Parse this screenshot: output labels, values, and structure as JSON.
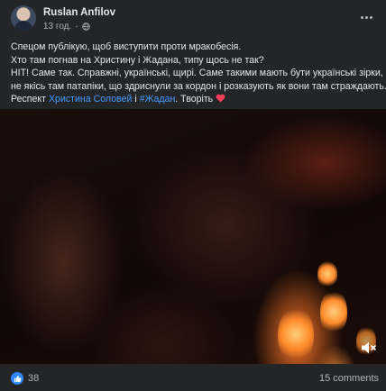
{
  "post": {
    "author": "Ruslan Anfilov",
    "time": "13 год.",
    "lines": [
      "Спецом публікую, щоб виступити проти мракобесія.",
      "Хто там погнав на Христину і Жадана, типу щось не так?",
      "НІТ! Саме так. Справжні, українські, щирі. Саме такими мають бути українські зірки, а",
      "не якісь там пaтапіки, що здриснули за кордон і розказують як вони там страждають."
    ],
    "respect_prefix": "Респект",
    "mention_1": "Христина Соловей",
    "mention_2": "#Жадан",
    "respect_suffix": ". Творіть"
  },
  "icons": {
    "visibility": "globe-icon",
    "more": "more-options-icon",
    "heart": "heart-icon",
    "volume": "speaker-muted-icon",
    "like": "thumbs-up-icon"
  },
  "stats": {
    "reactions": "38",
    "comments": "15 comments"
  },
  "colors": {
    "background": "#242526",
    "mention": "#4599ff",
    "like": "#2d88ff",
    "heart": "#f33e58"
  }
}
